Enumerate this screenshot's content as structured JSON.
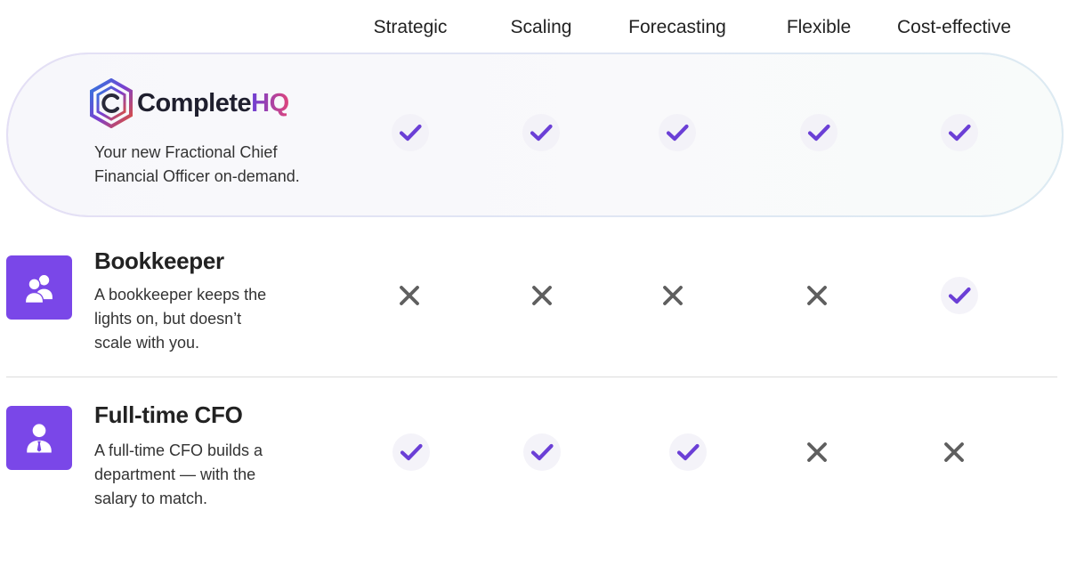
{
  "columns": [
    "Strategic",
    "Scaling",
    "Forecasting",
    "Flexible",
    "Cost-effective"
  ],
  "highlight": {
    "logo": {
      "name_main": "Complete",
      "name_accent": "HQ"
    },
    "description_line1": "Your new Fractional Chief",
    "description_line2": "Financial Officer on-demand.",
    "marks": [
      "check",
      "check",
      "check",
      "check",
      "check"
    ]
  },
  "rows": [
    {
      "title": "Bookkeeper",
      "icon": "users-icon",
      "description_lines": [
        "A bookkeeper keeps the",
        "lights on, but doesn’t",
        "scale with you."
      ],
      "marks": [
        "cross",
        "cross",
        "cross",
        "cross",
        "check"
      ]
    },
    {
      "title": "Full-time CFO",
      "icon": "person-tie-icon",
      "description_lines": [
        "A full-time CFO builds a",
        "department — with the",
        "salary to match."
      ],
      "marks": [
        "check",
        "check",
        "check",
        "cross",
        "cross"
      ]
    }
  ],
  "colors": {
    "accent": "#7a47e8",
    "check": "#6b3fd6",
    "cross": "#5f5f5f"
  }
}
